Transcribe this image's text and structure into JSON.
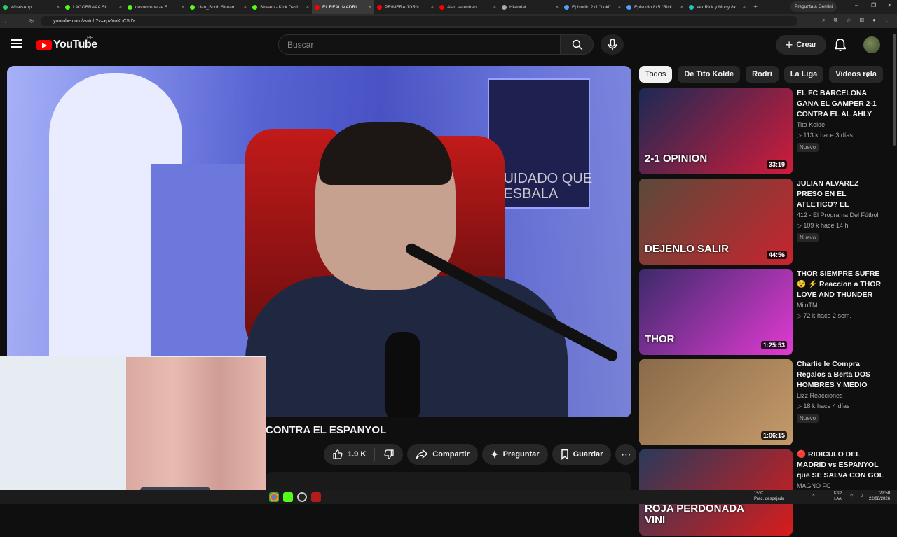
{
  "browser": {
    "tabs": [
      {
        "label": "WhatsApp",
        "color": "#25d366"
      },
      {
        "label": "LACOBRAAA Sh",
        "color": "#53fc18"
      },
      {
        "label": "davooxeneize S",
        "color": "#53fc18"
      },
      {
        "label": "Lian_Sorth Stream",
        "color": "#53fc18"
      },
      {
        "label": "Stream - Kick Dash",
        "color": "#53fc18"
      },
      {
        "label": "EL REAL MADRI",
        "color": "#ff0000"
      },
      {
        "label": "PRIMERA JORN",
        "color": "#ff0000"
      },
      {
        "label": "Alan se enfrent",
        "color": "#ff0000"
      },
      {
        "label": "Historial",
        "color": "#aaaaaa"
      },
      {
        "label": "Episodio 2x1 \"Loki\"",
        "color": "#4aa3ff"
      },
      {
        "label": "Episodio 8x5 \"Rick",
        "color": "#4aa3ff"
      },
      {
        "label": "Ver Rick y Morty 8x",
        "color": "#22c3c3"
      }
    ],
    "active_tab_index": 5,
    "new_tab": "+",
    "gemini_button": "Pregunta a Gemini",
    "url": "youtube.com/watch?v=xpzXoKpC5dY",
    "window_controls": [
      "–",
      "❐",
      "✕"
    ]
  },
  "header": {
    "logo_text": "YouTube",
    "country_code": "PE",
    "search_placeholder": "Buscar",
    "create_label": "Crear"
  },
  "video": {
    "title": "CONTRA EL ESPANYOL",
    "likes": "1.9 K",
    "share_label": "Compartir",
    "ask_label": "Preguntar",
    "save_label": "Guardar",
    "poster_text": "CUIDADO QUE RESBALA"
  },
  "chips": [
    "Todos",
    "De Tito Kolde",
    "Rodri",
    "La Liga",
    "Videos rela"
  ],
  "recommendations": [
    {
      "title": "EL FC BARCELONA GANA EL GAMPER 2-1 CONTRA EL AL AHLY",
      "channel": "Tito Kolde",
      "views": "113 k",
      "age": "hace 3 días",
      "badge": "Nuevo",
      "duration": "33:19",
      "thumb_text": "2-1 OPINION",
      "bg": "#1b2a55",
      "accent": "#d11b3a"
    },
    {
      "title": "JULIAN ALVAREZ PRESO EN EL ATLETICO? EL BARCELONA YA TIENE ...",
      "channel": "412 - El Programa Del Fútbol",
      "views": "109 k",
      "age": "hace 14 h",
      "badge": "Nuevo",
      "duration": "44:56",
      "thumb_text": "DEJENLO SALIR",
      "bg": "#5a4a3a",
      "accent": "#c8242f"
    },
    {
      "title": "THOR SIEMPRE SUFRE 😵 ⚡ Reaccion a THOR LOVE AND THUNDER po...",
      "channel": "MiluTM",
      "views": "72 k",
      "age": "hace 2 sem.",
      "badge": "",
      "duration": "1:25:53",
      "thumb_text": "THOR",
      "bg": "#3b2a6a",
      "accent": "#e23ad2"
    },
    {
      "title": "Charlie le Compra Regalos a Berta DOS HOMBRES Y MEDIO CAPITULOS ...",
      "channel": "Lizz Reacciones",
      "views": "18 k",
      "age": "hace 4 días",
      "badge": "Nuevo",
      "duration": "1:06:15",
      "thumb_text": "",
      "bg": "#8a6a4a",
      "accent": "#c49a6a"
    },
    {
      "title": "🔴 RIDICULO DEL MADRID vs ESPANYOL que SE SALVA CON GOL ...",
      "channel": "MAGNO FC",
      "views": "",
      "age": "",
      "badge": "",
      "duration": "",
      "thumb_text": "ROJA PERDONADA VINI",
      "bg": "#2a3a5a",
      "accent": "#d81c1c"
    }
  ],
  "taskbar": {
    "weather_temp": "15°C",
    "weather_desc": "Prac. despejado",
    "lang_top": "ESP",
    "lang_bottom": "LAA",
    "time": "22:50",
    "date": "22/08/2026"
  }
}
